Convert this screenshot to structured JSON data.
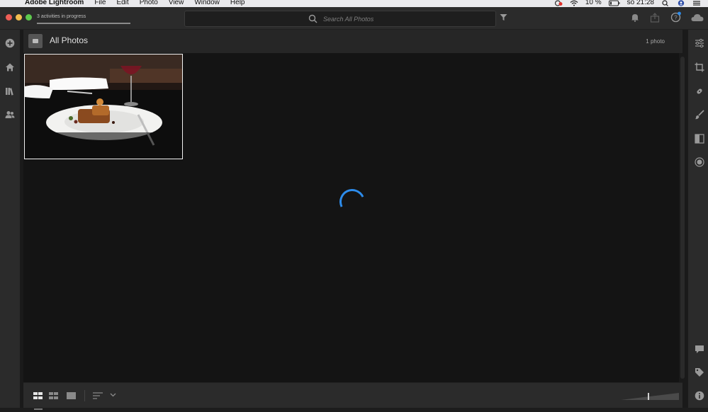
{
  "menubar": {
    "apple_glyph": "",
    "app_name": "Adobe Lightroom",
    "menus": [
      "File",
      "Edit",
      "Photo",
      "View",
      "Window",
      "Help"
    ],
    "battery": "10 %",
    "clock": "so 21:28"
  },
  "titlebar": {
    "activities": "3 activities in progress",
    "search_placeholder": "Search All Photos"
  },
  "header": {
    "title": "All Photos",
    "count": "1 photo"
  },
  "colors": {
    "accent": "#2d8ceb",
    "thumb_border": "#f2f2f2",
    "background": "#141414"
  },
  "left_rail_icons": [
    "add-photos-icon",
    "home-icon",
    "library-icon",
    "people-icon"
  ],
  "right_rail_icons": [
    "edit-sliders-icon",
    "crop-icon",
    "healing-icon",
    "brush-icon",
    "linear-gradient-icon",
    "radial-gradient-icon",
    "comments-icon",
    "keywords-icon",
    "info-icon"
  ],
  "bottom_icons": [
    "square-grid-icon",
    "photo-grid-icon",
    "detail-view-icon",
    "sort-icon",
    "chevron-down-icon"
  ]
}
